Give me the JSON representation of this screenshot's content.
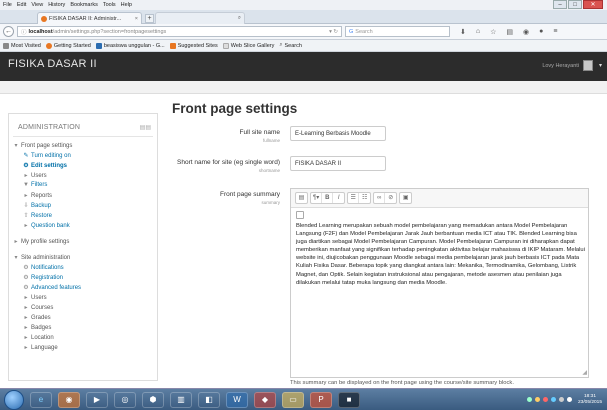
{
  "browser": {
    "menu": [
      "File",
      "Edit",
      "View",
      "History",
      "Bookmarks",
      "Tools",
      "Help"
    ],
    "active_tab": "FISIKA DASAR II: Administr...",
    "inactive_tab": "",
    "url_host": "localhost",
    "url_path": "/admin/settings.php?section=frontpagesettings",
    "search_placeholder": "Search",
    "bookmarks": [
      {
        "label": "Most Visited",
        "color": "#888888"
      },
      {
        "label": "Getting Started",
        "color": "#e87722"
      },
      {
        "label": "beasiswa unggulan - G...",
        "color": "#2b6cb0"
      },
      {
        "label": "Suggested Sites",
        "color": "#e87722"
      },
      {
        "label": "Web Slice Gallery",
        "color": "#dddddd"
      },
      {
        "label": "Search",
        "color": "#ffffff"
      }
    ]
  },
  "header": {
    "site_title": "FISIKA DASAR II",
    "user_name": "Lovy Herayanti"
  },
  "sidebar": {
    "title": "ADMINISTRATION",
    "items": [
      {
        "label": "Front page settings"
      },
      {
        "label": "Turn editing on"
      },
      {
        "label": "Edit settings"
      },
      {
        "label": "Users"
      },
      {
        "label": "Filters"
      },
      {
        "label": "Reports"
      },
      {
        "label": "Backup"
      },
      {
        "label": "Restore"
      },
      {
        "label": "Question bank"
      },
      {
        "label": "My profile settings"
      },
      {
        "label": "Site administration"
      },
      {
        "label": "Notifications"
      },
      {
        "label": "Registration"
      },
      {
        "label": "Advanced features"
      },
      {
        "label": "Users"
      },
      {
        "label": "Courses"
      },
      {
        "label": "Grades"
      },
      {
        "label": "Badges"
      },
      {
        "label": "Location"
      },
      {
        "label": "Language"
      }
    ]
  },
  "main": {
    "page_title": "Front page settings",
    "full_site_name": {
      "label": "Full site name",
      "sub": "fullname",
      "value": "E-Learning Berbasis Moodle"
    },
    "short_name": {
      "label": "Short name for site (eg single word)",
      "sub": "shortname",
      "value": "FISIKA DASAR II"
    },
    "summary": {
      "label": "Front page summary",
      "sub": "summary",
      "text": "Blended Learning merupakan sebuah model pembelajaran yang memadukan antara Model Pembelajaran Langsung (F2F) dan Model Pembelajaran Jarak Jauh berbantuan media ICT atau TIK. Blended Learning bisa juga diartikan sebagai Model Pembelajaran Campuran. Model Pembelajaran Campuran ini diharapkan dapat memberikan manfaat yang signifikan terhadap peningkatan aktivitas belajar mahasiswa di IKIP Mataram. Melalui website ini, diujicobakan penggunaan Moodle sebagai media pembelajaran jarak jauh berbasis ICT pada Mata Kuliah Fisika Dasar. Beberapa topik yang diangkat antara lain: Mekanika, Termodinamika, Gelombang, Listrik Magnet, dan Optik. Selain kegiatan instruksional atau pengajaran, metode asesmen atau penilaian juga dilakukan melalui tatap muka langsung dan media Moodle.",
      "help": "This summary can be displayed on the front page using the course/site summary block."
    }
  },
  "taskbar": {
    "time": "18:31",
    "date": "23/05/2015"
  },
  "colors": {
    "header_bg": "#2c2c2c",
    "link": "#0070a8",
    "taskbar": "#3a5b80"
  }
}
